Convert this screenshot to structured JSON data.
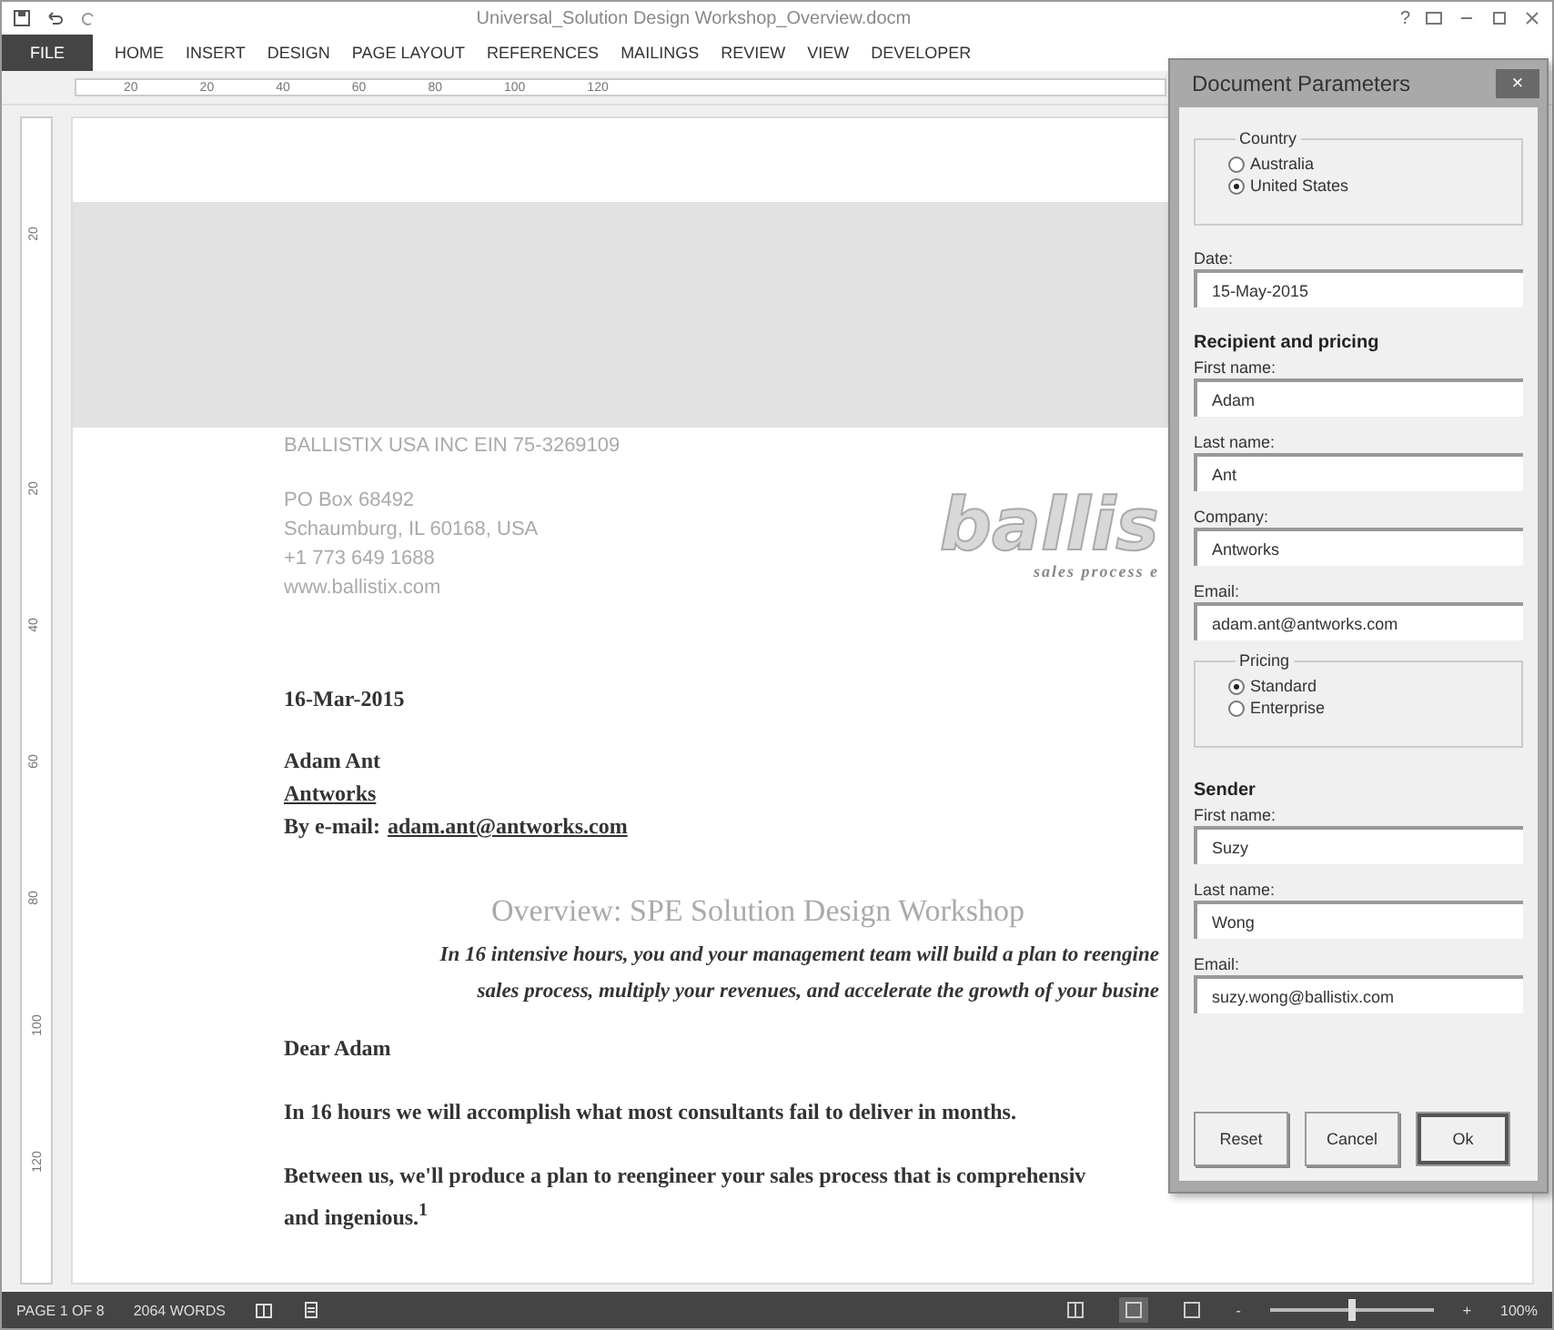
{
  "title_bar": {
    "title": "Universal_Solution Design Workshop_Overview.docm",
    "help": "?"
  },
  "ribbon_tabs": [
    {
      "label": "FILE",
      "kind": "file"
    },
    {
      "label": "HOME",
      "kind": "tab"
    },
    {
      "label": "INSERT",
      "kind": "tab"
    },
    {
      "label": "DESIGN",
      "kind": "tab"
    },
    {
      "label": "PAGE LAYOUT",
      "kind": "tab"
    },
    {
      "label": "REFERENCES",
      "kind": "tab"
    },
    {
      "label": "MAILINGS",
      "kind": "tab"
    },
    {
      "label": "REVIEW",
      "kind": "tab"
    },
    {
      "label": "VIEW",
      "kind": "tab"
    },
    {
      "label": "DEVELOPER",
      "kind": "tab"
    }
  ],
  "ruler": {
    "h_labels": [
      "20",
      "20",
      "40",
      "60",
      "80",
      "100",
      "120"
    ],
    "v_labels": [
      "20",
      "20",
      "40",
      "60",
      "80",
      "100",
      "120"
    ]
  },
  "document": {
    "company_line": "BALLISTIX USA INC  EIN 75-3269109",
    "address": [
      "PO Box 68492",
      "Schaumburg, IL 60168, USA",
      "+1 773 649 1688",
      "www.ballistix.com"
    ],
    "logo_text": "ballis",
    "tagline": "sales process e",
    "date": "16-Mar-2015",
    "recipient_name": "Adam Ant",
    "recipient_company": "Antworks",
    "email_label": "By e-mail:",
    "email": "adam.ant@antworks.com",
    "heading": "Overview: SPE Solution Design Workshop",
    "intro": [
      "In 16 intensive hours, you and your management team will build a plan to reengine",
      "sales process, multiply your revenues, and accelerate the growth of your busine"
    ],
    "salutation": "Dear Adam",
    "paragraphs": [
      [
        "In 16 hours we will accomplish what most consultants fail to deliver in months."
      ],
      [
        "Between us, we'll produce a plan to reengineer your sales process that is comprehensiv",
        "and ingenious.$^{1}$"
      ]
    ]
  },
  "dialog": {
    "title": "Document Parameters",
    "close": "×",
    "items": [
      {
        "kind": "group",
        "legend": "Country",
        "options": [
          {
            "label": "Australia",
            "selected": false
          },
          {
            "label": "United States",
            "selected": true
          }
        ]
      },
      {
        "kind": "field",
        "label": "Date:",
        "value": "15-May-2015"
      },
      {
        "kind": "heading",
        "text": "Recipient and pricing"
      },
      {
        "kind": "field",
        "label": "First name:",
        "value": "Adam"
      },
      {
        "kind": "field",
        "label": "Last name:",
        "value": "Ant"
      },
      {
        "kind": "field",
        "label": "Company:",
        "value": "Antworks"
      },
      {
        "kind": "field",
        "label": "Email:",
        "value": "adam.ant@antworks.com"
      },
      {
        "kind": "group",
        "legend": "Pricing",
        "options": [
          {
            "label": "Standard",
            "selected": true
          },
          {
            "label": "Enterprise",
            "selected": false
          }
        ]
      },
      {
        "kind": "heading",
        "text": "Sender"
      },
      {
        "kind": "field",
        "label": "First name:",
        "value": "Suzy"
      },
      {
        "kind": "field",
        "label": "Last name:",
        "value": "Wong"
      },
      {
        "kind": "field",
        "label": "Email:",
        "value": "suzy.wong@ballistix.com"
      }
    ],
    "buttons": [
      {
        "label": "Reset",
        "default": false
      },
      {
        "label": "Cancel",
        "default": false
      },
      {
        "label": "Ok",
        "default": true
      }
    ]
  },
  "status_bar": {
    "page": "PAGE 1 OF 8",
    "words": "2064 WORDS",
    "views": [
      {
        "selected": false
      },
      {
        "selected": true
      },
      {
        "selected": false
      }
    ],
    "zoom_minus": "-",
    "zoom_plus": "+",
    "zoom": {
      "level": 0.5
    },
    "zoom_text": "100%"
  }
}
